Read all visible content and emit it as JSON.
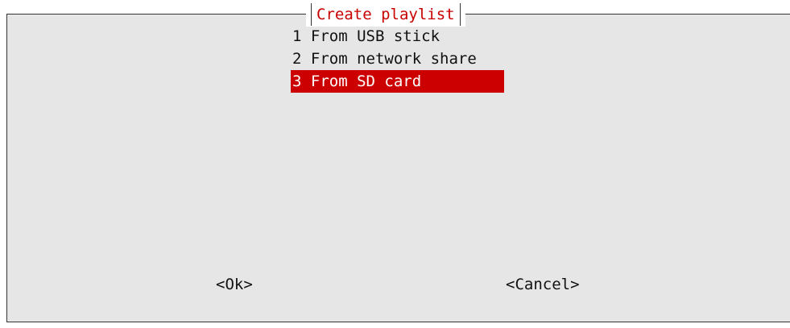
{
  "dialog": {
    "title": "Create playlist",
    "menu_items": [
      {
        "label": "1 From USB stick",
        "selected": false
      },
      {
        "label": "2 From network share",
        "selected": false
      },
      {
        "label": "3 From SD card",
        "selected": true
      }
    ],
    "buttons": {
      "ok_label": "<Ok>",
      "cancel_label": "<Cancel>"
    }
  },
  "colors": {
    "dialog_background": "#e6e6e6",
    "title_text": "#c80000",
    "selected_background": "#cc0000",
    "selected_text": "#ffffff",
    "border": "#333333"
  }
}
